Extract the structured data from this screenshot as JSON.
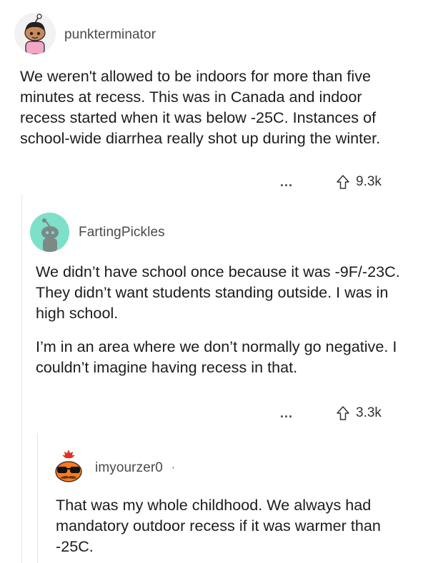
{
  "comments": [
    {
      "username": "punkterminator",
      "body": [
        "We weren't allowed to be indoors for more than five minutes at recess. This was in Canada and indoor recess started when it was below -25C. Instances of school-wide diarrhea really shot up during the winter."
      ],
      "more": "...",
      "votes": "9.3k",
      "avatar_icon": "snoo-avatar-icon"
    },
    {
      "username": "FartingPickles",
      "body": [
        "We didn’t have school once because it was -9F/-23C.  They didn’t want students standing outside.  I was in high school.",
        "I’m in an area where we don’t normally go negative.  I couldn’t imagine having recess in that."
      ],
      "more": "...",
      "votes": "3.3k",
      "avatar_icon": "snoo-avatar-icon"
    },
    {
      "username": "imyourzer0",
      "separator": "·",
      "body": [
        "That was my whole childhood. We always had mandatory outdoor recess if it was warmer than -25C."
      ],
      "avatar_icon": "snoo-avatar-icon"
    }
  ],
  "colors": {
    "teal_avatar": "#7ee0c8",
    "text": "#1c1c1c",
    "muted": "#4a4a4a"
  }
}
